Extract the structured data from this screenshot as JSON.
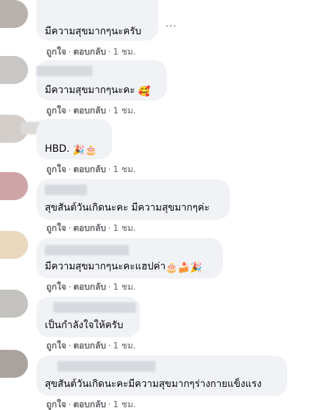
{
  "comments": [
    {
      "text": "มีความสุขมากๆนะครับ",
      "emoji": "",
      "like": "ถูกใจ",
      "reply": "ตอบกลับ",
      "time": "1 ชม.",
      "avatar_color": "#b8b2ad"
    },
    {
      "text": "มีความสุขมากๆนะคะ",
      "emoji": "🥰",
      "like": "ถูกใจ",
      "reply": "ตอบกลับ",
      "time": "1 ชม.",
      "avatar_color": "#c9c7c6"
    },
    {
      "text": "HBD.",
      "emoji": "🎉🎂",
      "like": "ถูกใจ",
      "reply": "ตอบกลับ",
      "time": "1 ชม.",
      "avatar_color": "#d3ceca"
    },
    {
      "text": "สุขสันต์วันเกิดนะคะ มีความสุขมากๆค่ะ",
      "emoji": "",
      "like": "ถูกใจ",
      "reply": "ตอบกลับ",
      "time": "1 ชม.",
      "avatar_color": "#cfa4a6"
    },
    {
      "text": "มีความสุขมากๆนะคะแฮปค่า",
      "emoji": "🎂🍰🎉",
      "like": "ถูกใจ",
      "reply": "ตอบกลับ",
      "time": "1 ชม.",
      "avatar_color": "#ead9bf"
    },
    {
      "text": "เป็นกำลังใจให้ครับ",
      "emoji": "",
      "like": "ถูกใจ",
      "reply": "ตอบกลับ",
      "time": "1 ชม.",
      "avatar_color": "#c5c3c0"
    },
    {
      "text": "สุขสันต์วันเกิดนะคะมีความสุขมากๆร่างกายแข็งแรง",
      "emoji": "",
      "like": "ถูกใจ",
      "reply": "ตอบกลับ",
      "time": "1 ชม.",
      "avatar_color": "#a9a29e"
    }
  ],
  "more_icon": "ellipsis-icon",
  "more_label": "..."
}
